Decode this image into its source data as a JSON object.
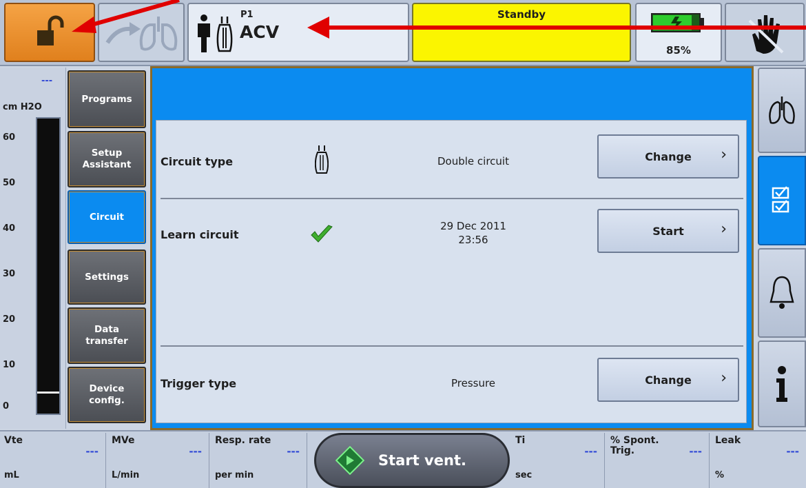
{
  "topbar": {
    "patient_slot": "P1",
    "mode": "ACV",
    "status": "Standby",
    "battery_percent": "85%",
    "battery_level": 0.85
  },
  "pressure": {
    "value": "---",
    "unit": "cm H2O",
    "ticks": [
      "60",
      "50",
      "40",
      "30",
      "20",
      "10",
      "0"
    ]
  },
  "nav": {
    "programs": "Programs",
    "setup_assistant": "Setup\nAssistant",
    "circuit": "Circuit",
    "settings": "Settings",
    "data_transfer": "Data\ntransfer",
    "device_config": "Device\nconfig."
  },
  "rows": {
    "circuit_type": {
      "label": "Circuit type",
      "value": "Double circuit",
      "action": "Change"
    },
    "learn_circuit": {
      "label": "Learn circuit",
      "date": "29 Dec 2011",
      "time": "23:56",
      "action": "Start"
    },
    "trigger_type": {
      "label": "Trigger type",
      "value": "Pressure",
      "action": "Change"
    }
  },
  "bottom": {
    "vte": {
      "label": "Vte",
      "value": "---",
      "unit": "mL"
    },
    "mve": {
      "label": "MVe",
      "value": "---",
      "unit": "L/min"
    },
    "resp_rate": {
      "label": "Resp. rate",
      "value": "---",
      "unit": "per min"
    },
    "start_label": "Start vent.",
    "ti": {
      "label": "Ti",
      "value": "---",
      "unit": "sec"
    },
    "spont_trig": {
      "label": "% Spont.\nTrig.",
      "value": "---"
    },
    "leak": {
      "label": "Leak",
      "value": "---",
      "unit": "%"
    }
  },
  "colors": {
    "accent_blue": "#0b8bf0",
    "standby_yellow": "#fbf500",
    "lock_orange": "#ee9434",
    "value_blue": "#3048d6",
    "arrow_red": "#e00000"
  },
  "icons": [
    "unlock-icon",
    "lung-arrow-icon",
    "person-icon",
    "circuit-icon",
    "battery-icon",
    "hand-silence-icon",
    "check-icon",
    "lungs-icon",
    "checklist-icon",
    "bell-icon",
    "info-icon",
    "start-icon"
  ]
}
